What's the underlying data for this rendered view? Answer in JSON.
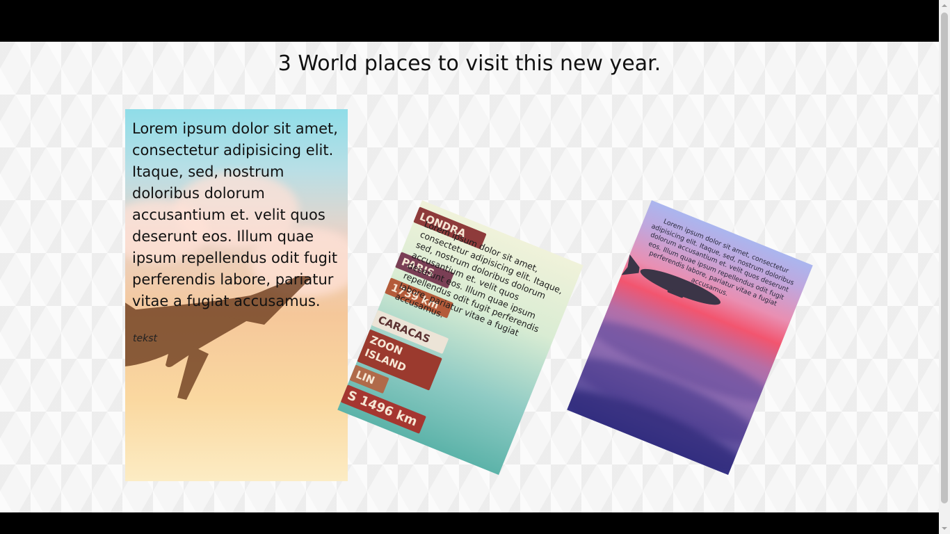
{
  "page": {
    "title": "3 World places to visit this new year."
  },
  "cards": [
    {
      "text": "Lorem ipsum dolor sit amet, consectetur adipisicing elit. Itaque, sed, nostrum doloribus dolorum accusantium et. velit quos deserunt eos. Illum quae ipsum repellendus odit fugit perferendis labore, pariatur vitae a fugiat accusamus.",
      "caption": "tekst"
    },
    {
      "text": "Lorem ipsum dolor sit amet, consectetur adipisicing elit. Itaque, sed, nostrum doloribus dolorum accusantium et. velit quos deserunt eos. Illum quae ipsum repellendus odit fugit perferendis labore, pariatur vitae a fugiat accusamus.",
      "sign_texts": [
        "LONDRA",
        "PARIS",
        "1739 km",
        "CARACAS",
        "ZOON ISLAND",
        "LIN",
        "S 1496 km"
      ]
    },
    {
      "text": "Lorem ipsum dolor sit amet, consectetur adipisicing elit. Itaque, sed, nostrum doloribus dolorum accusantium et. velit quos deserunt eos. Illum quae ipsum repellendus odit fugit perferendis labore, pariatur vitae a fugiat accusamus."
    }
  ],
  "colors": {
    "top_bar": "#000000",
    "page_background": "#f6f6f6",
    "card_1_sky": "#8fdde8",
    "card_1_sunset": "#f5c79a",
    "card_2_sea": "#5cb3a9",
    "card_2_signs": "#8b2e2e",
    "card_3_sky": "#aab6ef",
    "card_3_glow": "#f2556f",
    "card_3_clouds": "#3e3c92"
  }
}
